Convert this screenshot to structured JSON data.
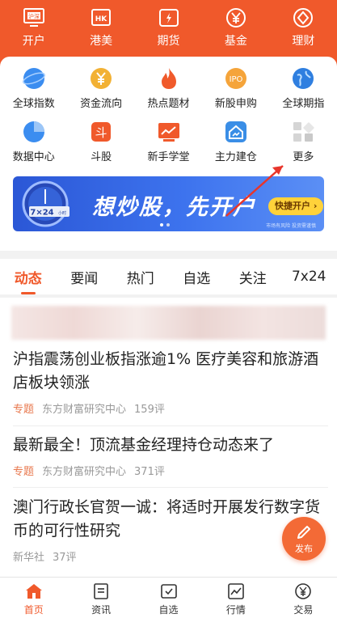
{
  "top_nav": [
    {
      "label": "开户",
      "icon": "open-account-icon",
      "badge": "沪深"
    },
    {
      "label": "港美",
      "icon": "hk-us-icon",
      "badge": "HK"
    },
    {
      "label": "期货",
      "icon": "futures-icon"
    },
    {
      "label": "基金",
      "icon": "fund-yen-icon"
    },
    {
      "label": "理财",
      "icon": "wealth-icon"
    }
  ],
  "grid": [
    {
      "label": "全球指数",
      "icon": "globe-icon"
    },
    {
      "label": "资金流向",
      "icon": "fund-flow-icon"
    },
    {
      "label": "热点题材",
      "icon": "flame-icon"
    },
    {
      "label": "新股申购",
      "icon": "ipo-icon",
      "badge": "IPO"
    },
    {
      "label": "全球期指",
      "icon": "global-futures-icon"
    },
    {
      "label": "数据中心",
      "icon": "pie-chart-icon"
    },
    {
      "label": "斗股",
      "icon": "dou-stock-icon",
      "badge": "斗"
    },
    {
      "label": "新手学堂",
      "icon": "classroom-icon"
    },
    {
      "label": "主力建仓",
      "icon": "house-chart-icon"
    },
    {
      "label": "更多",
      "icon": "more-grid-icon"
    }
  ],
  "banner": {
    "slogan": "想炒股，先开户",
    "cta": "快捷开户 ›",
    "clock_text": "7×24",
    "clock_sub": "小时",
    "note": "市场有风险 投资需谨慎"
  },
  "tabs": [
    "动态",
    "要闻",
    "热门",
    "自选",
    "关注",
    "7x24"
  ],
  "active_tab": 0,
  "news": [
    {
      "title": "沪指震荡创业板指涨逾1% 医疗美容和旅游酒店板块领涨",
      "tag": "专题",
      "source": "东方财富研究中心",
      "comments": "159评"
    },
    {
      "title": "最新最全！顶流基金经理持仓动态来了",
      "tag": "专题",
      "source": "东方财富研究中心",
      "comments": "371评"
    },
    {
      "title": "澳门行政长官贺一诚：将适时开展发行数字货币的可行性研究",
      "tag": "",
      "source": "新华社",
      "comments": "37评"
    }
  ],
  "fab_label": "发布",
  "bottom_nav": [
    {
      "label": "首页",
      "icon": "home-icon"
    },
    {
      "label": "资讯",
      "icon": "news-icon"
    },
    {
      "label": "自选",
      "icon": "watchlist-icon"
    },
    {
      "label": "行情",
      "icon": "market-chart-icon"
    },
    {
      "label": "交易",
      "icon": "trade-yen-icon"
    }
  ],
  "colors": {
    "brand": "#f0592b",
    "banner": "#2b57d6",
    "cta": "#ffd23a",
    "tag": "#e8774c"
  }
}
